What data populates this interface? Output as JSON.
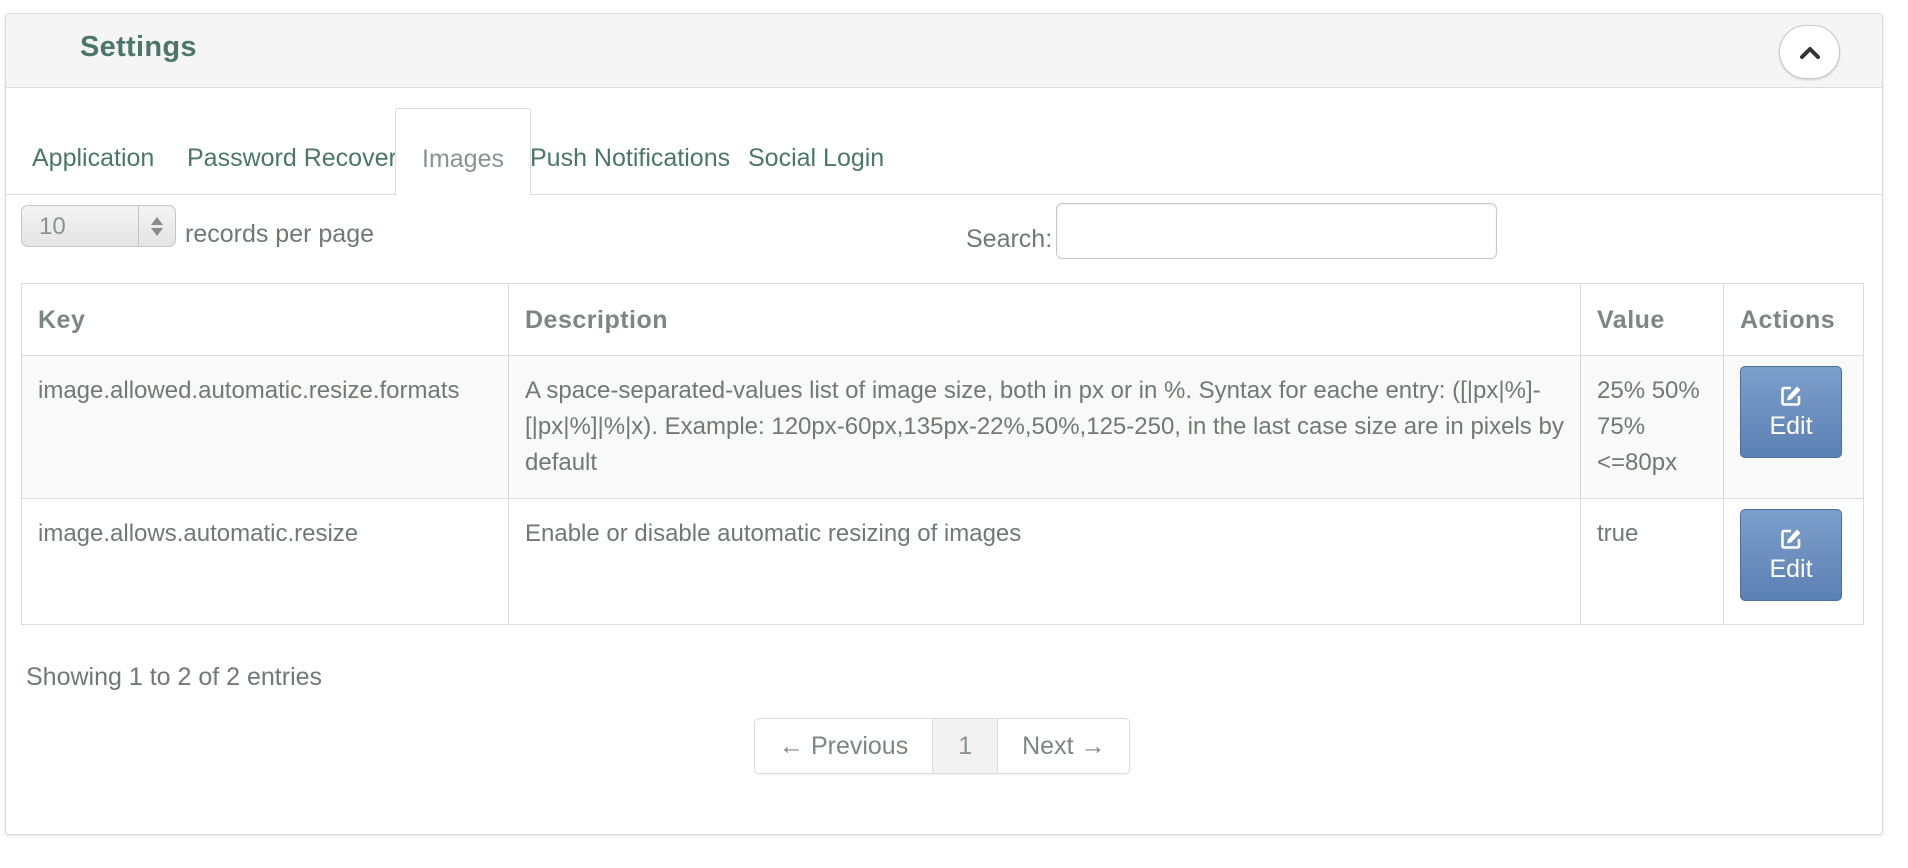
{
  "header": {
    "title": "Settings",
    "collapse_icon": "chevron-up-icon"
  },
  "tabs": [
    {
      "label": "Application",
      "active": false
    },
    {
      "label": "Password Recovery",
      "active": false
    },
    {
      "label": "Images",
      "active": true
    },
    {
      "label": "Push Notifications",
      "active": false
    },
    {
      "label": "Social Login",
      "active": false
    }
  ],
  "length": {
    "value": "10",
    "label": "records per page"
  },
  "search": {
    "label": "Search:",
    "value": "",
    "placeholder": ""
  },
  "table": {
    "columns": [
      "Key",
      "Description",
      "Value",
      "Actions"
    ],
    "rows": [
      {
        "key": "image.allowed.automatic.resize.formats",
        "description": "A space-separated-values list of image size, both in px or in %. Syntax for eache entry: ([|px|%]-[|px|%]|%|x). Example: 120px-60px,135px-22%,50%,125-250, in the last case size are in pixels by default",
        "value_lines": [
          "25% 50%",
          "75%",
          "<=80px"
        ],
        "action": "Edit"
      },
      {
        "key": "image.allows.automatic.resize",
        "description": "Enable or disable automatic resizing of images",
        "value_lines": [
          "true"
        ],
        "action": "Edit"
      }
    ]
  },
  "info": "Showing 1 to 2 of 2 entries",
  "pagination": {
    "previous": "← Previous",
    "current": "1",
    "next": "Next →"
  },
  "colors": {
    "accent": "#4a7769",
    "text": "#6f7a73",
    "button": "#6a8fc1"
  }
}
